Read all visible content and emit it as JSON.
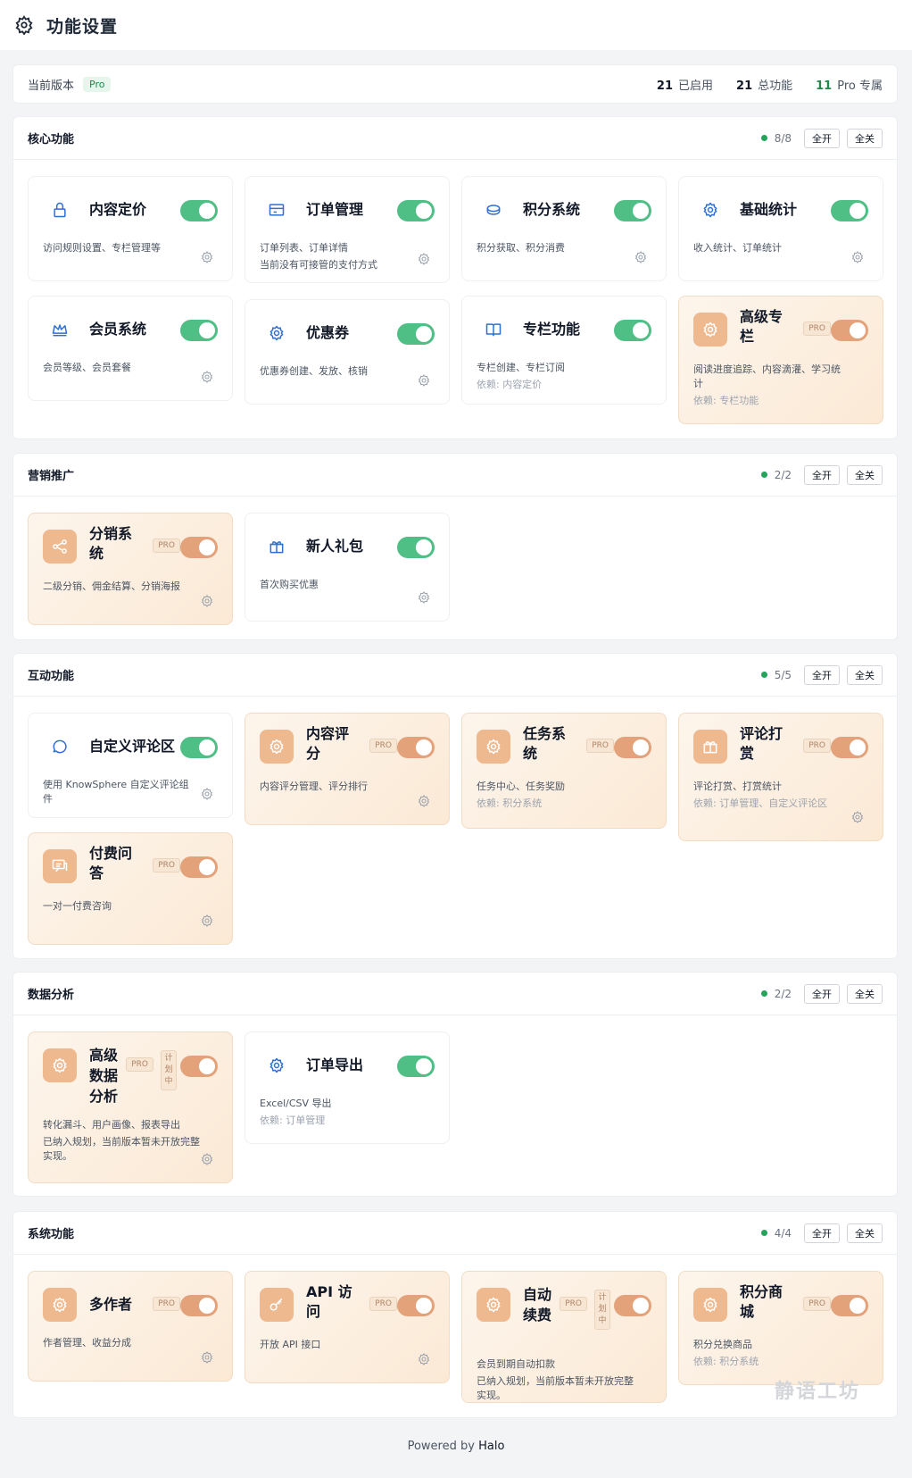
{
  "header": {
    "title": "功能设置"
  },
  "version": {
    "label": "当前版本",
    "badge": "Pro",
    "enabled_num": "21",
    "enabled_label": "已启用",
    "total_num": "21",
    "total_label": "总功能",
    "pro_num": "11",
    "pro_label": "Pro 专属"
  },
  "buttons": {
    "all_on": "全开",
    "all_off": "全关"
  },
  "tags": {
    "pro": "PRO",
    "plan": "计划中"
  },
  "sections": [
    {
      "title": "核心功能",
      "count": "8/8",
      "cards": [
        {
          "name": "内容定价",
          "icon": "lock-icon",
          "desc": "访问规则设置、专栏管理等",
          "pro": false
        },
        {
          "name": "订单管理",
          "icon": "window-icon",
          "desc": "订单列表、订单详情",
          "note": "当前没有可接管的支付方式",
          "pro": false
        },
        {
          "name": "积分系统",
          "icon": "coin-icon",
          "desc": "积分获取、积分消费",
          "pro": false
        },
        {
          "name": "基础统计",
          "icon": "gear-icon",
          "desc": "收入统计、订单统计",
          "pro": false
        },
        {
          "name": "会员系统",
          "icon": "crown-icon",
          "desc": "会员等级、会员套餐",
          "pro": false
        },
        {
          "name": "优惠券",
          "icon": "gear-icon",
          "desc": "优惠券创建、发放、核销",
          "pro": false
        },
        {
          "name": "专栏功能",
          "icon": "book-icon",
          "desc": "专栏创建、专栏订阅",
          "dep": "依赖: 内容定价",
          "pro": false
        },
        {
          "name": "高级专栏",
          "icon": "gear-icon",
          "desc": "阅读进度追踪、内容滴灌、学习统计",
          "dep": "依赖: 专栏功能",
          "pro": true
        }
      ]
    },
    {
      "title": "营销推广",
      "count": "2/2",
      "cards": [
        {
          "name": "分销系统",
          "icon": "share-icon",
          "desc": "二级分销、佣金结算、分销海报",
          "pro": true
        },
        {
          "name": "新人礼包",
          "icon": "gift-icon",
          "desc": "首次购买优惠",
          "pro": false
        }
      ]
    },
    {
      "title": "互动功能",
      "count": "5/5",
      "cards": [
        {
          "name": "自定义评论区",
          "icon": "chat-icon",
          "desc": "使用 KnowSphere 自定义评论组件",
          "pro": false
        },
        {
          "name": "内容评分",
          "icon": "gear-icon",
          "desc": "内容评分管理、评分排行",
          "pro": true
        },
        {
          "name": "任务系统",
          "icon": "gear-icon",
          "desc": "任务中心、任务奖励",
          "dep": "依赖: 积分系统",
          "pro": true
        },
        {
          "name": "评论打赏",
          "icon": "gift-icon",
          "desc": "评论打赏、打赏统计",
          "dep": "依赖: 订单管理、自定义评论区",
          "pro": true
        },
        {
          "name": "付费问答",
          "icon": "qa-icon",
          "desc": "一对一付费咨询",
          "pro": true
        }
      ]
    },
    {
      "title": "数据分析",
      "count": "2/2",
      "cards": [
        {
          "name": "高级数据分析",
          "icon": "gear-icon",
          "desc": "转化漏斗、用户画像、报表导出",
          "note": "已纳入规划，当前版本暂未开放完整实现。",
          "pro": true,
          "planned": true
        },
        {
          "name": "订单导出",
          "icon": "gear-icon",
          "desc": "Excel/CSV 导出",
          "dep": "依赖: 订单管理",
          "pro": false
        }
      ]
    },
    {
      "title": "系统功能",
      "count": "4/4",
      "cards": [
        {
          "name": "多作者",
          "icon": "gear-icon",
          "desc": "作者管理、收益分成",
          "pro": true
        },
        {
          "name": "API 访问",
          "icon": "key-icon",
          "desc": "开放 API 接口",
          "pro": true
        },
        {
          "name": "自动续费",
          "icon": "gear-icon",
          "desc": "会员到期自动扣款",
          "note": "已纳入规划，当前版本暂未开放完整实现。",
          "pro": true,
          "planned": true
        },
        {
          "name": "积分商城",
          "icon": "gear-icon",
          "desc": "积分兑换商品",
          "dep": "依赖: 积分系统",
          "pro": true
        }
      ]
    }
  ],
  "footer": {
    "prefix": "Powered by",
    "brand": "Halo"
  },
  "watermark": "静语工坊"
}
